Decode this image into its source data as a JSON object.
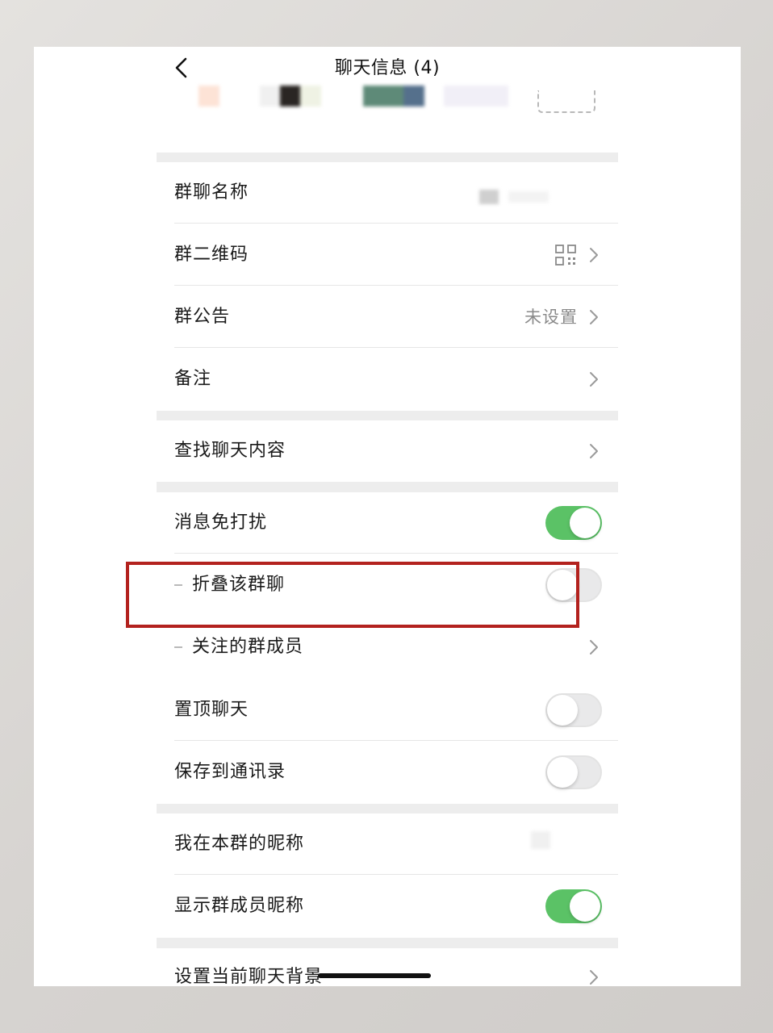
{
  "header": {
    "title": "聊天信息 (4)"
  },
  "group_name": {
    "label": "群聊名称"
  },
  "group_qr": {
    "label": "群二维码"
  },
  "announcement": {
    "label": "群公告",
    "value": "未设置"
  },
  "remark": {
    "label": "备注"
  },
  "search_history": {
    "label": "查找聊天内容"
  },
  "mute": {
    "label": "消息免打扰",
    "on": true
  },
  "fold_chat": {
    "label": "折叠该群聊",
    "on": false
  },
  "followed_members": {
    "label": "关注的群成员"
  },
  "pin_chat": {
    "label": "置顶聊天",
    "on": false
  },
  "save_contacts": {
    "label": "保存到通讯录",
    "on": false
  },
  "my_nickname": {
    "label": "我在本群的昵称"
  },
  "show_nicknames": {
    "label": "显示群成员昵称",
    "on": true
  },
  "chat_background": {
    "label": "设置当前聊天背景"
  },
  "colors": {
    "toggle_on": "#5bc266",
    "highlight_border": "#b3221e",
    "section_gap": "#ededed"
  },
  "icons": [
    "chevron-left-icon",
    "qr-code-icon",
    "chevron-right-icon"
  ]
}
